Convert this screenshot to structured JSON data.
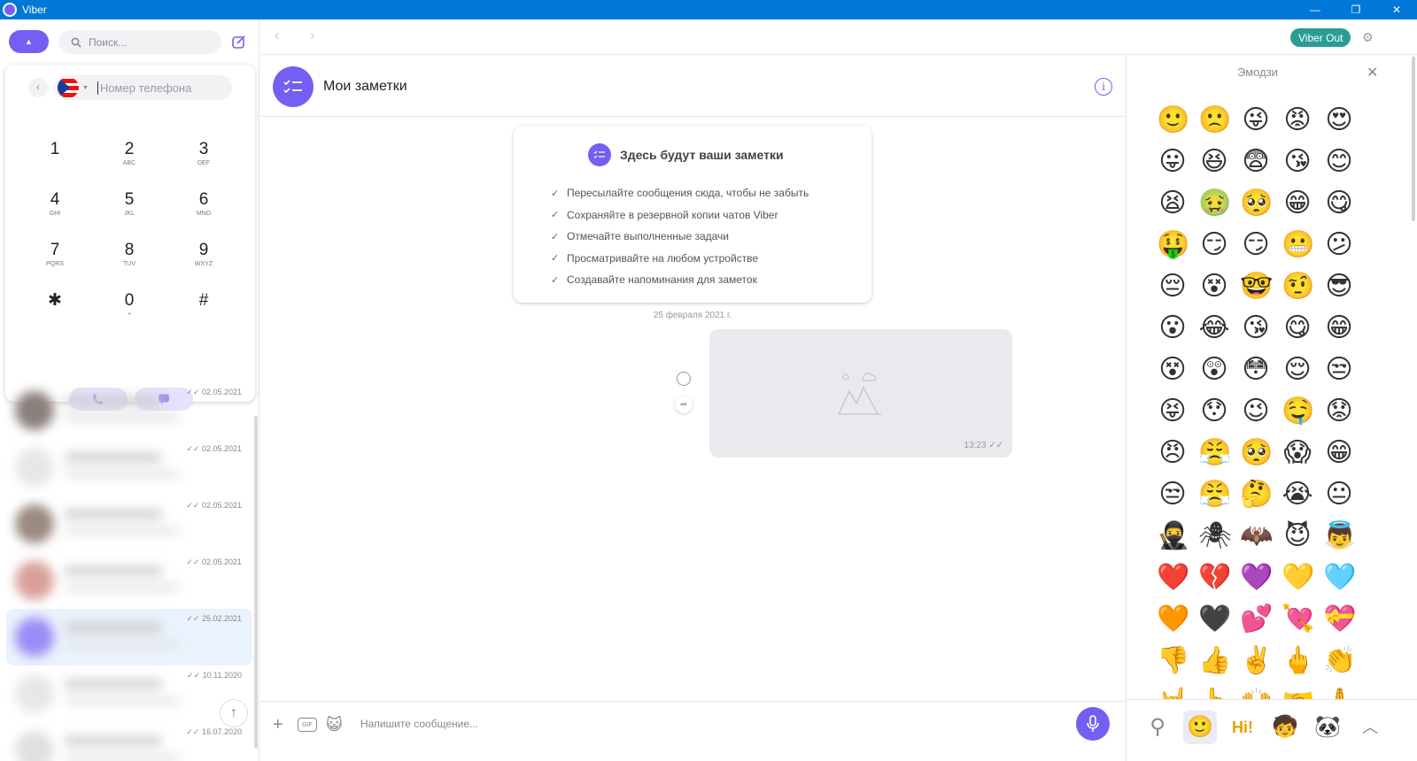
{
  "window": {
    "title": "Viber",
    "controls": [
      "—",
      "❐",
      "✕"
    ]
  },
  "sidebar": {
    "search_placeholder": "Поиск...",
    "dialer": {
      "phone_placeholder": "Номер телефона",
      "keys": [
        {
          "num": "1",
          "sub": ""
        },
        {
          "num": "2",
          "sub": "ABC"
        },
        {
          "num": "3",
          "sub": "DEF"
        },
        {
          "num": "4",
          "sub": "GHI"
        },
        {
          "num": "5",
          "sub": "JKL"
        },
        {
          "num": "6",
          "sub": "MNO"
        },
        {
          "num": "7",
          "sub": "PQRS"
        },
        {
          "num": "8",
          "sub": "TUV"
        },
        {
          "num": "9",
          "sub": "WXYZ"
        },
        {
          "num": "✱",
          "sub": ""
        },
        {
          "num": "0",
          "sub": "+"
        },
        {
          "num": "#",
          "sub": ""
        }
      ]
    },
    "chats": [
      {
        "date": "02.05.2021",
        "avatar_color": "#8a7f7a"
      },
      {
        "date": "02.05.2021",
        "avatar_color": "#e7e7e7"
      },
      {
        "date": "02.05.2021",
        "avatar_color": "#9a8a80"
      },
      {
        "date": "02.05.2021",
        "avatar_color": "#d9a09a"
      },
      {
        "date": "25.02.2021",
        "avatar_color": "#9b8cf5"
      },
      {
        "date": "10.11.2020",
        "avatar_color": "#e7e7e7"
      },
      {
        "date": "16.07.2020",
        "avatar_color": "#e0e0e0"
      }
    ]
  },
  "topnav": {
    "viber_out": "Viber Out"
  },
  "chat": {
    "title": "Мои заметки",
    "card_title": "Здесь будут ваши заметки",
    "card_items": [
      "Пересылайте сообщения сюда, чтобы не забыть",
      "Сохраняйте в резервной копии чатов Viber",
      "Отмечайте выполненные задачи",
      "Просматривайте на любом устройстве",
      "Создавайте напоминания для заметок"
    ],
    "date_separator": "25 февраля 2021 г.",
    "message_time": "13:23",
    "input_placeholder": "Напишите сообщение...",
    "accent": "#7360f2"
  },
  "emoji_panel": {
    "title": "Эмодзи",
    "emojis": [
      "🙂",
      "🙁",
      "😜",
      "😡",
      "😍",
      "😛",
      "😆",
      "😨",
      "😘",
      "😊",
      "😫",
      "🤢",
      "🥺",
      "😁",
      "😋",
      "🤑",
      "😏",
      "😏",
      "😬",
      "😕",
      "😔",
      "😵",
      "🤓",
      "🤨",
      "😎",
      "😮",
      "😂",
      "😘",
      "😋",
      "😁",
      "😵",
      "😲",
      "😳",
      "😌",
      "😒",
      "😝",
      "😯",
      "😉",
      "🤤",
      "😟",
      "😠",
      "😤",
      "🥺",
      "😱",
      "😁",
      "😒",
      "😤",
      "🤔",
      "😭",
      "😐",
      "🥷",
      "🕷",
      "🦇",
      "😈",
      "👼",
      "❤️",
      "💔",
      "💜",
      "💛",
      "🩵",
      "🧡",
      "🖤",
      "💕",
      "💘",
      "💝",
      "👎",
      "👍",
      "✌️",
      "🖕",
      "👏",
      "🤘",
      "👆",
      "🙌",
      "🤝",
      "🙏"
    ],
    "tabs": [
      "search-icon",
      "emoji-tab",
      "hi-sticker",
      "kid-sticker",
      "panda-sticker",
      "collapse-icon"
    ]
  }
}
